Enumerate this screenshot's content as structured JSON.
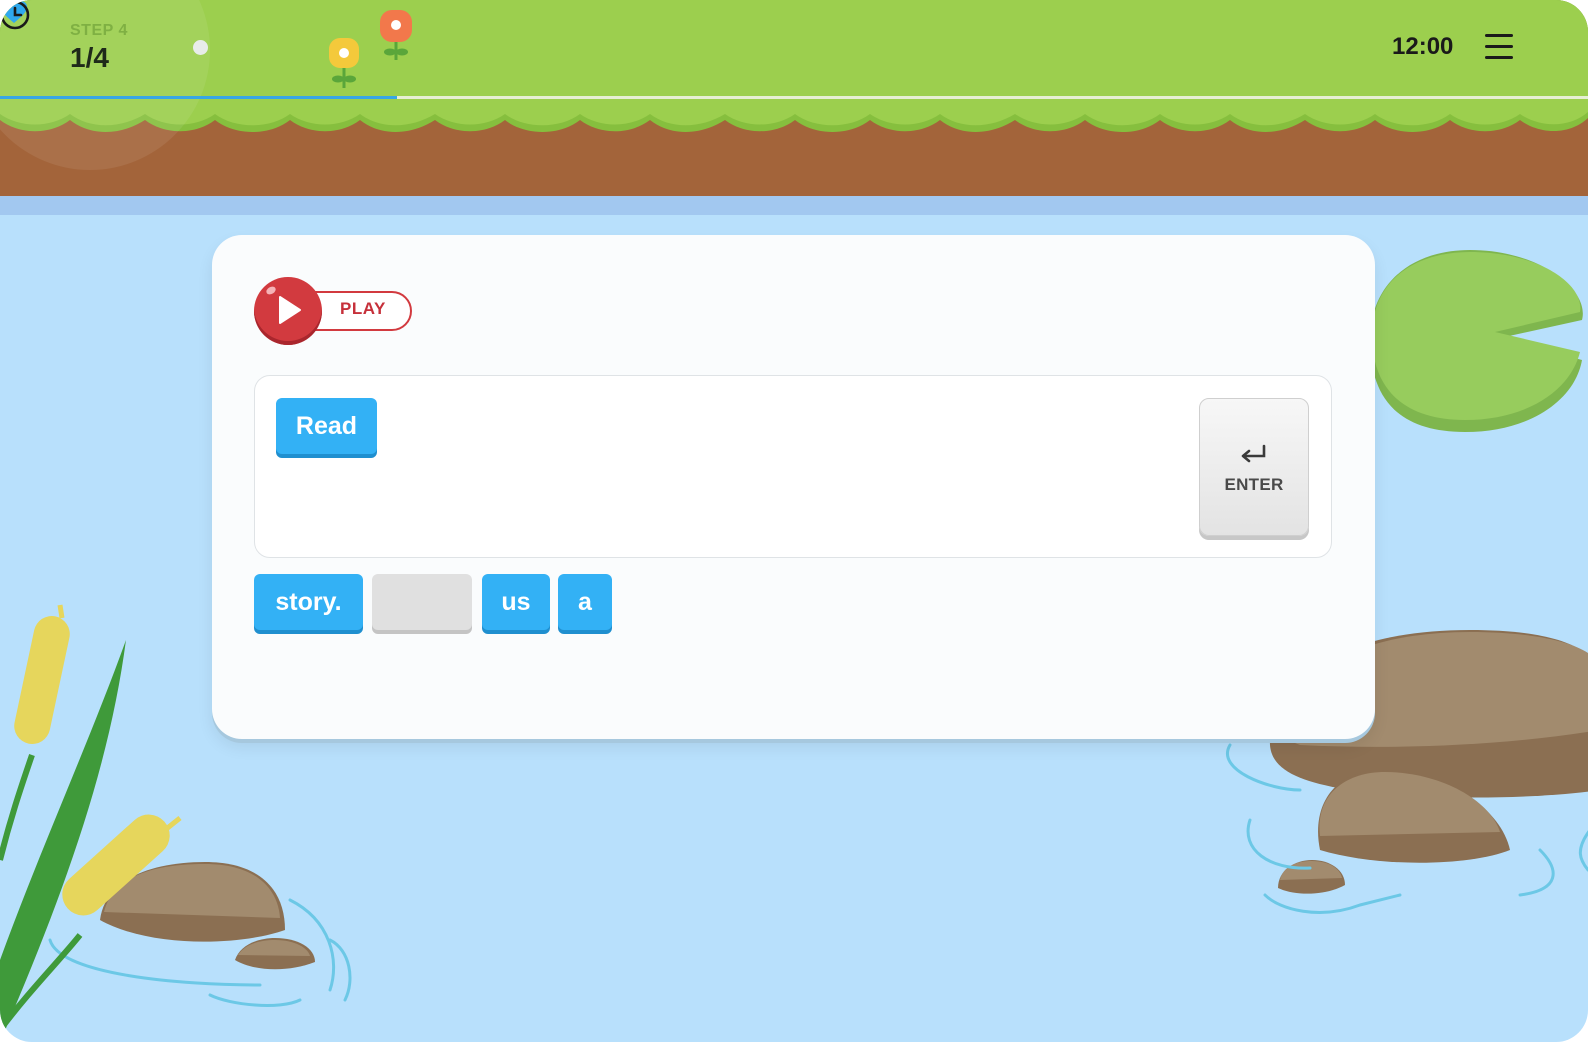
{
  "header": {
    "step_label": "STEP 4",
    "step_count": "1/4",
    "time": "12:00",
    "progress": 0.25
  },
  "player": {
    "play_label": "PLAY"
  },
  "answer": {
    "placed_words": [
      "Read"
    ],
    "enter_label": "ENTER"
  },
  "word_bank": [
    "story.",
    "",
    "us",
    "a"
  ],
  "colors": {
    "grass": "#9ccf4e",
    "dirt": "#a3643a",
    "water": "#b8e0fc",
    "chip": "#33b1f5",
    "play": "#d23a3f"
  },
  "icons": [
    "heart-icon",
    "clock-icon",
    "menu-icon",
    "play-icon",
    "enter-icon"
  ]
}
